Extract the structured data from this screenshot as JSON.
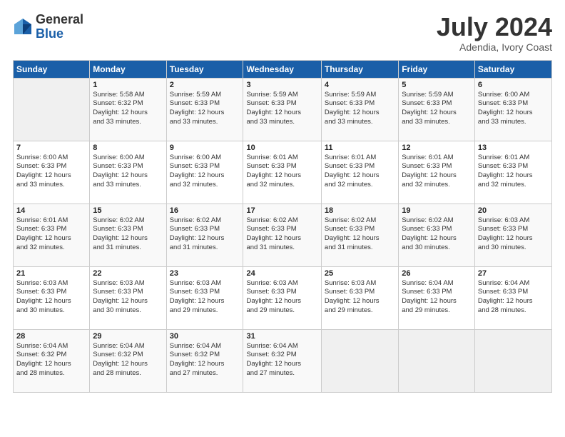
{
  "header": {
    "logo_general": "General",
    "logo_blue": "Blue",
    "main_title": "July 2024",
    "subtitle": "Adendia, Ivory Coast"
  },
  "calendar": {
    "days_of_week": [
      "Sunday",
      "Monday",
      "Tuesday",
      "Wednesday",
      "Thursday",
      "Friday",
      "Saturday"
    ],
    "weeks": [
      [
        {
          "day": "",
          "info": ""
        },
        {
          "day": "1",
          "info": "Sunrise: 5:58 AM\nSunset: 6:32 PM\nDaylight: 12 hours\nand 33 minutes."
        },
        {
          "day": "2",
          "info": "Sunrise: 5:59 AM\nSunset: 6:33 PM\nDaylight: 12 hours\nand 33 minutes."
        },
        {
          "day": "3",
          "info": "Sunrise: 5:59 AM\nSunset: 6:33 PM\nDaylight: 12 hours\nand 33 minutes."
        },
        {
          "day": "4",
          "info": "Sunrise: 5:59 AM\nSunset: 6:33 PM\nDaylight: 12 hours\nand 33 minutes."
        },
        {
          "day": "5",
          "info": "Sunrise: 5:59 AM\nSunset: 6:33 PM\nDaylight: 12 hours\nand 33 minutes."
        },
        {
          "day": "6",
          "info": "Sunrise: 6:00 AM\nSunset: 6:33 PM\nDaylight: 12 hours\nand 33 minutes."
        }
      ],
      [
        {
          "day": "7",
          "info": "Sunrise: 6:00 AM\nSunset: 6:33 PM\nDaylight: 12 hours\nand 33 minutes."
        },
        {
          "day": "8",
          "info": "Sunrise: 6:00 AM\nSunset: 6:33 PM\nDaylight: 12 hours\nand 33 minutes."
        },
        {
          "day": "9",
          "info": "Sunrise: 6:00 AM\nSunset: 6:33 PM\nDaylight: 12 hours\nand 32 minutes."
        },
        {
          "day": "10",
          "info": "Sunrise: 6:01 AM\nSunset: 6:33 PM\nDaylight: 12 hours\nand 32 minutes."
        },
        {
          "day": "11",
          "info": "Sunrise: 6:01 AM\nSunset: 6:33 PM\nDaylight: 12 hours\nand 32 minutes."
        },
        {
          "day": "12",
          "info": "Sunrise: 6:01 AM\nSunset: 6:33 PM\nDaylight: 12 hours\nand 32 minutes."
        },
        {
          "day": "13",
          "info": "Sunrise: 6:01 AM\nSunset: 6:33 PM\nDaylight: 12 hours\nand 32 minutes."
        }
      ],
      [
        {
          "day": "14",
          "info": "Sunrise: 6:01 AM\nSunset: 6:33 PM\nDaylight: 12 hours\nand 32 minutes."
        },
        {
          "day": "15",
          "info": "Sunrise: 6:02 AM\nSunset: 6:33 PM\nDaylight: 12 hours\nand 31 minutes."
        },
        {
          "day": "16",
          "info": "Sunrise: 6:02 AM\nSunset: 6:33 PM\nDaylight: 12 hours\nand 31 minutes."
        },
        {
          "day": "17",
          "info": "Sunrise: 6:02 AM\nSunset: 6:33 PM\nDaylight: 12 hours\nand 31 minutes."
        },
        {
          "day": "18",
          "info": "Sunrise: 6:02 AM\nSunset: 6:33 PM\nDaylight: 12 hours\nand 31 minutes."
        },
        {
          "day": "19",
          "info": "Sunrise: 6:02 AM\nSunset: 6:33 PM\nDaylight: 12 hours\nand 30 minutes."
        },
        {
          "day": "20",
          "info": "Sunrise: 6:03 AM\nSunset: 6:33 PM\nDaylight: 12 hours\nand 30 minutes."
        }
      ],
      [
        {
          "day": "21",
          "info": "Sunrise: 6:03 AM\nSunset: 6:33 PM\nDaylight: 12 hours\nand 30 minutes."
        },
        {
          "day": "22",
          "info": "Sunrise: 6:03 AM\nSunset: 6:33 PM\nDaylight: 12 hours\nand 30 minutes."
        },
        {
          "day": "23",
          "info": "Sunrise: 6:03 AM\nSunset: 6:33 PM\nDaylight: 12 hours\nand 29 minutes."
        },
        {
          "day": "24",
          "info": "Sunrise: 6:03 AM\nSunset: 6:33 PM\nDaylight: 12 hours\nand 29 minutes."
        },
        {
          "day": "25",
          "info": "Sunrise: 6:03 AM\nSunset: 6:33 PM\nDaylight: 12 hours\nand 29 minutes."
        },
        {
          "day": "26",
          "info": "Sunrise: 6:04 AM\nSunset: 6:33 PM\nDaylight: 12 hours\nand 29 minutes."
        },
        {
          "day": "27",
          "info": "Sunrise: 6:04 AM\nSunset: 6:33 PM\nDaylight: 12 hours\nand 28 minutes."
        }
      ],
      [
        {
          "day": "28",
          "info": "Sunrise: 6:04 AM\nSunset: 6:32 PM\nDaylight: 12 hours\nand 28 minutes."
        },
        {
          "day": "29",
          "info": "Sunrise: 6:04 AM\nSunset: 6:32 PM\nDaylight: 12 hours\nand 28 minutes."
        },
        {
          "day": "30",
          "info": "Sunrise: 6:04 AM\nSunset: 6:32 PM\nDaylight: 12 hours\nand 27 minutes."
        },
        {
          "day": "31",
          "info": "Sunrise: 6:04 AM\nSunset: 6:32 PM\nDaylight: 12 hours\nand 27 minutes."
        },
        {
          "day": "",
          "info": ""
        },
        {
          "day": "",
          "info": ""
        },
        {
          "day": "",
          "info": ""
        }
      ]
    ]
  }
}
